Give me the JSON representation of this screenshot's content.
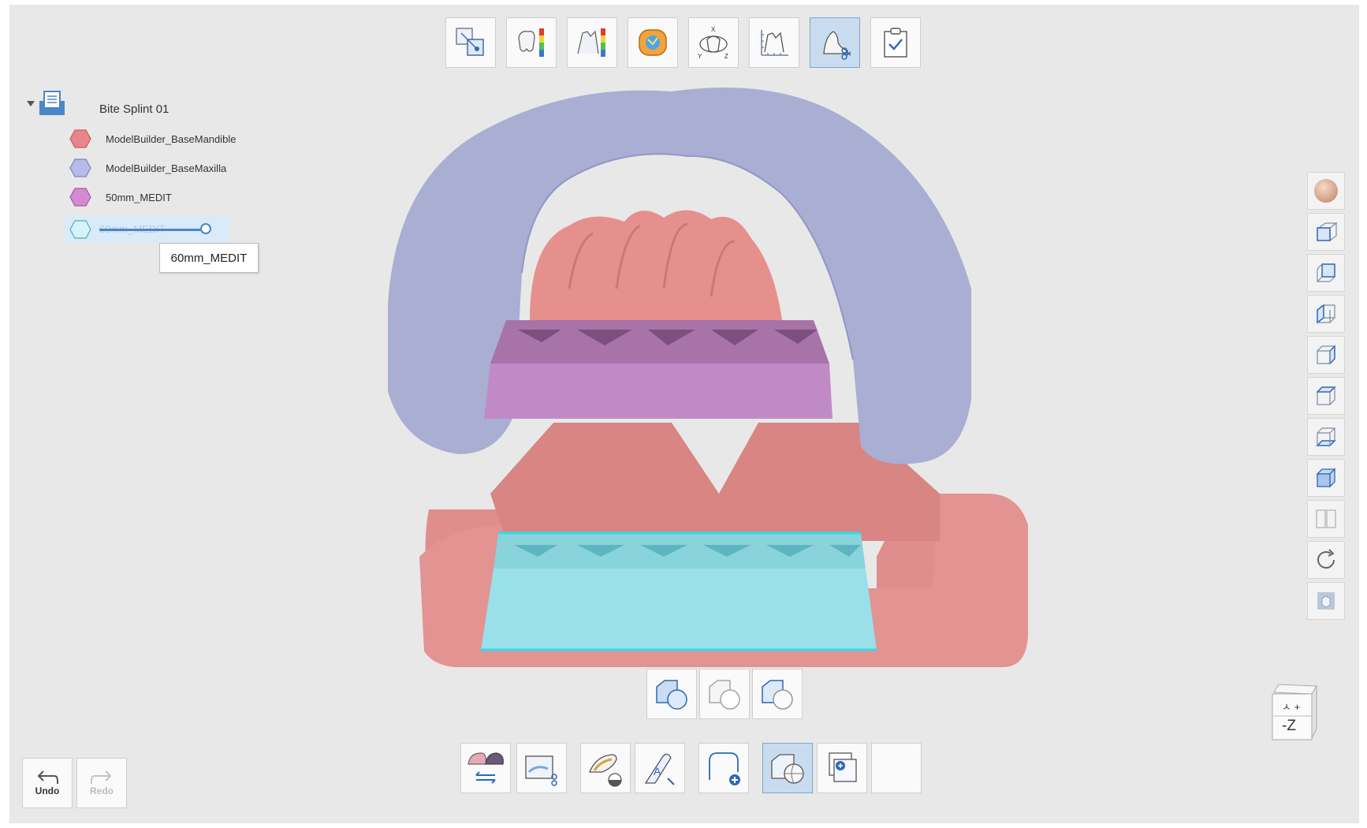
{
  "top_toolbar": {
    "tools": [
      {
        "name": "align-tool",
        "active": false
      },
      {
        "name": "deviation-tool",
        "active": false
      },
      {
        "name": "section-tool",
        "active": false
      },
      {
        "name": "occlusion-tool",
        "active": false
      },
      {
        "name": "axis-tool",
        "active": false
      },
      {
        "name": "measure-tool",
        "active": false
      },
      {
        "name": "trim-tool",
        "active": true
      },
      {
        "name": "complete-tool",
        "active": false
      }
    ]
  },
  "tree": {
    "project_label": "Bite Splint 01",
    "items": [
      {
        "label": "ModelBuilder_BaseMandible",
        "color": "#e8878a"
      },
      {
        "label": "ModelBuilder_BaseMaxilla",
        "color": "#b7b9e6"
      },
      {
        "label": "50mm_MEDIT",
        "color": "#d58bd2"
      },
      {
        "label": "60mm_MEDIT",
        "color": "#a8e6f0"
      }
    ],
    "slider_value": 1.0,
    "tooltip": "60mm_MEDIT"
  },
  "right_toolbar": {
    "items": [
      "material-view",
      "view-front",
      "view-back",
      "view-left",
      "view-right",
      "view-top",
      "view-bottom",
      "view-iso",
      "split-view",
      "reset-view",
      "single-view"
    ]
  },
  "view_cube": {
    "top_label": "ㅅ +",
    "front_label": "-Z"
  },
  "mid_toolbar": {
    "items": [
      "boolean-union",
      "boolean-subtract",
      "boolean-intersect"
    ]
  },
  "bottom_toolbar": {
    "items": [
      "swap-models",
      "trim-area",
      "remove-bubble",
      "text-emboss",
      "add-margin",
      "boolean-tool",
      "add-object",
      "empty-slot"
    ]
  },
  "history": {
    "undo_label": "Undo",
    "redo_label": "Redo"
  },
  "colors": {
    "mandible": "#e8878a",
    "maxilla": "#a9aed2",
    "block50": "#c088c8",
    "block60": "#99dde4",
    "accent": "#4a86c8"
  }
}
